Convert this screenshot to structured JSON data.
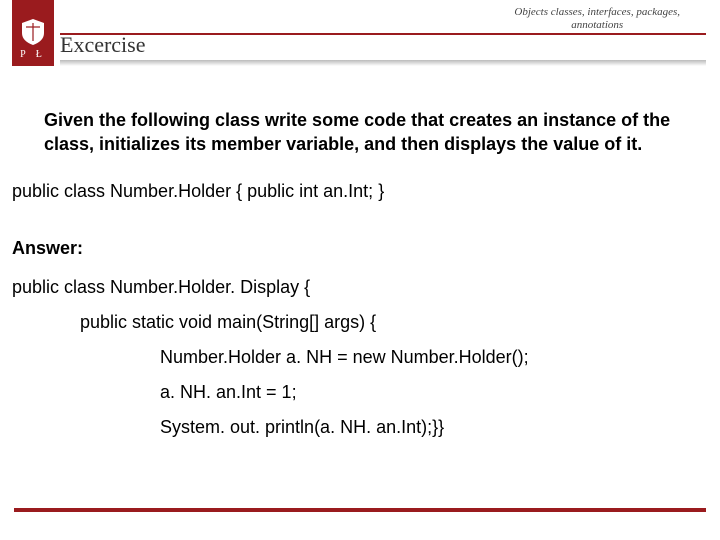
{
  "header": {
    "topic_line1": "Objects classes, interfaces, packages,",
    "topic_line2": "annotations",
    "title": "Excercise",
    "logo_letters": "P   Ł"
  },
  "body": {
    "prompt": "Given the following class write some code that creates an instance of the class, initializes its member variable, and then displays the value of it.",
    "given_code": "public class Number.Holder { public int an.Int; }",
    "answer_label": "Answer:",
    "answer_lines": [
      "public class Number.Holder. Display {",
      "public static void main(String[] args) {",
      "Number.Holder a. NH = new Number.Holder();",
      "a. NH. an.Int = 1;",
      "System. out. println(a. NH. an.Int);}}"
    ]
  }
}
